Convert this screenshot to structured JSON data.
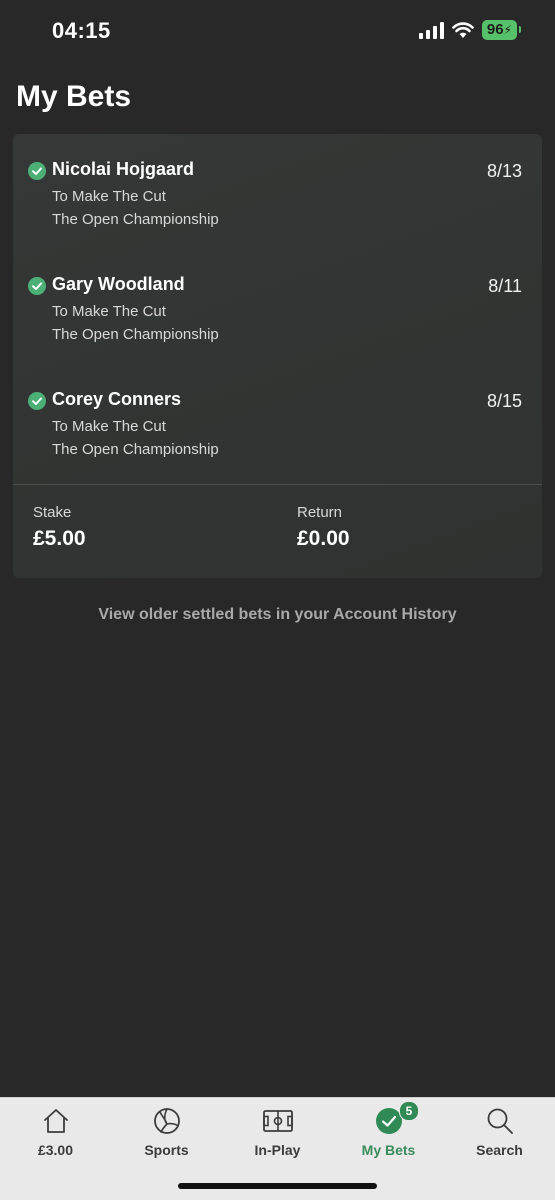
{
  "status_bar": {
    "time": "04:15",
    "battery": "96"
  },
  "page": {
    "title": "My Bets"
  },
  "bet": {
    "selections": [
      {
        "name": "Nicolai Hojgaard",
        "odds": "8/13",
        "market": "To Make The Cut",
        "event": "The Open Championship"
      },
      {
        "name": "Gary Woodland",
        "odds": "8/11",
        "market": "To Make The Cut",
        "event": "The Open Championship"
      },
      {
        "name": "Corey Conners",
        "odds": "8/15",
        "market": "To Make The Cut",
        "event": "The Open Championship"
      }
    ],
    "stake_label": "Stake",
    "stake_value": "£5.00",
    "return_label": "Return",
    "return_value": "£0.00"
  },
  "history_link": "View older settled bets in your Account History",
  "tab_bar": {
    "tabs": [
      {
        "label": "£3.00",
        "icon": "home-icon"
      },
      {
        "label": "Sports",
        "icon": "football-icon"
      },
      {
        "label": "In-Play",
        "icon": "pitch-icon"
      },
      {
        "label": "My Bets",
        "icon": "check-circle-icon",
        "badge": "5"
      },
      {
        "label": "Search",
        "icon": "search-icon"
      }
    ]
  },
  "colors": {
    "background": "#282828",
    "card": "#343735",
    "accent_green": "#3a8c5c",
    "check_green": "#4caf76",
    "battery_green": "#57c06a",
    "tab_bar": "#e9e9e9"
  }
}
